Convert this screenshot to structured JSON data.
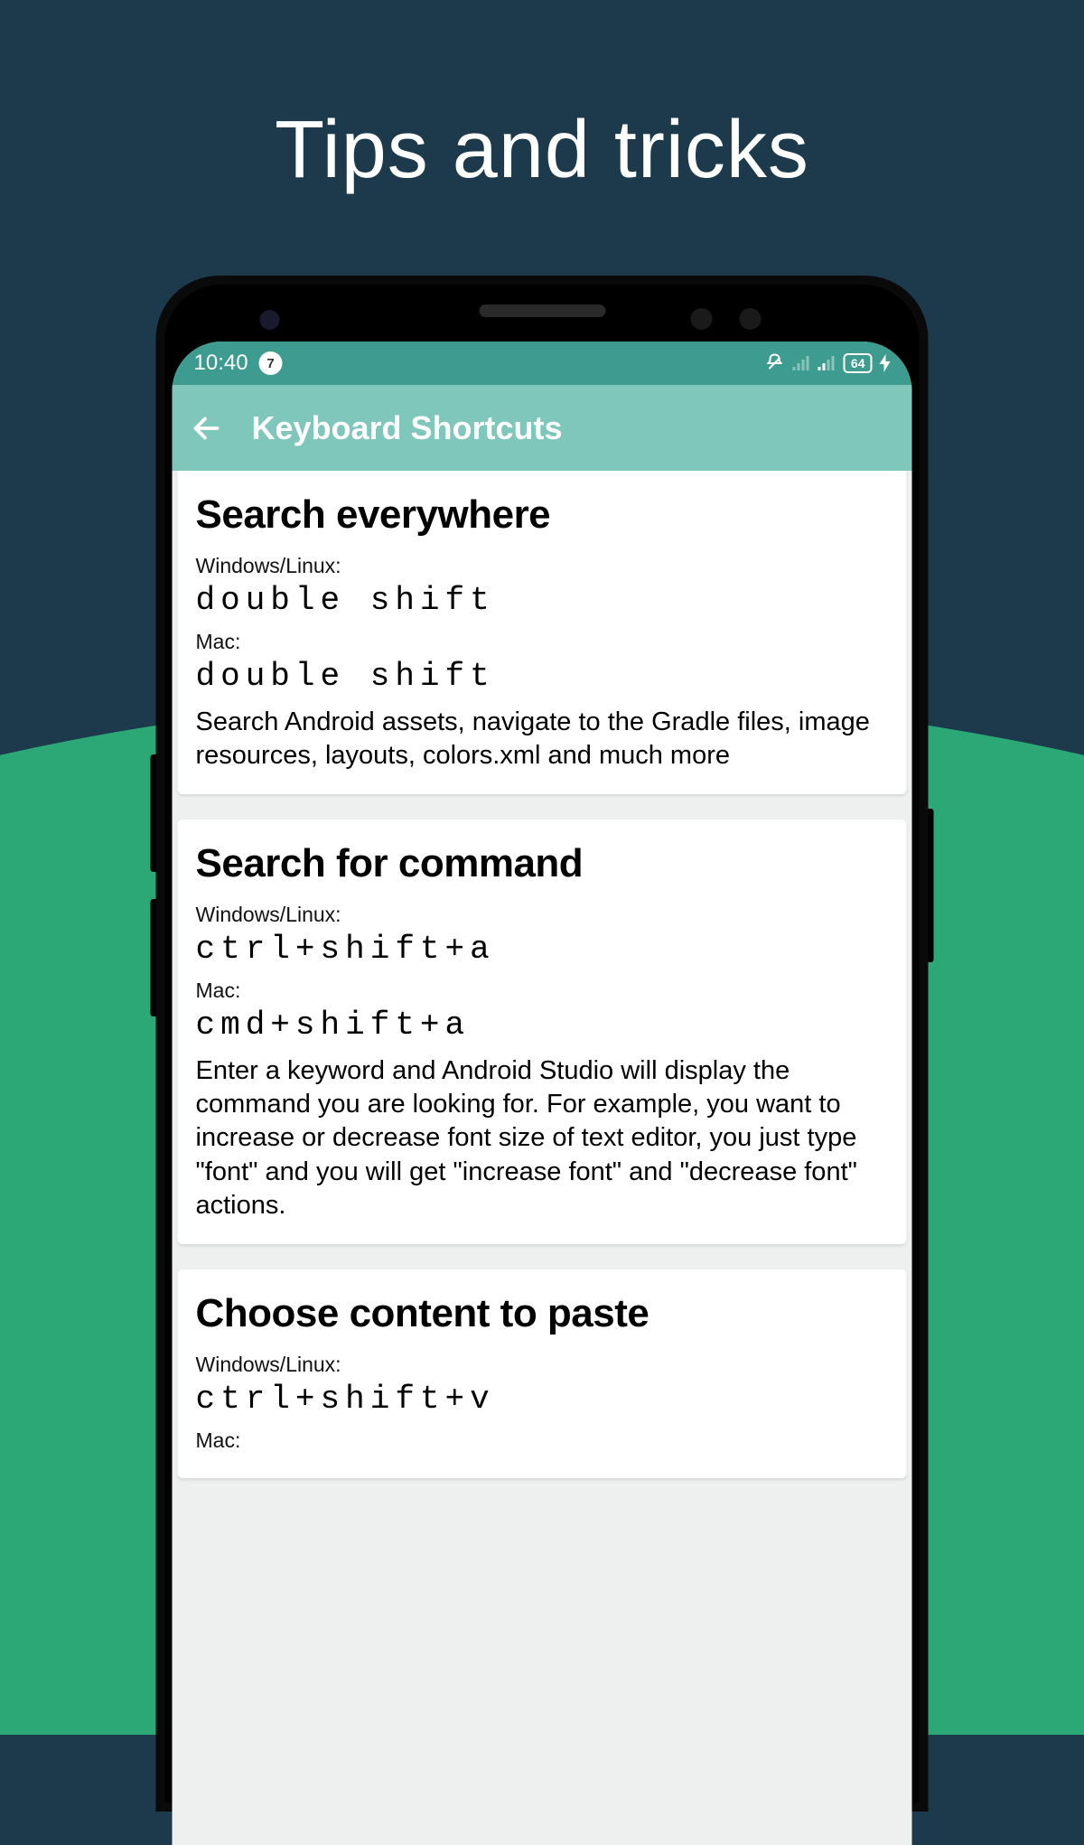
{
  "page": {
    "title": "Tips and tricks"
  },
  "status_bar": {
    "time": "10:40",
    "notification_count": "7",
    "battery": "64"
  },
  "app_bar": {
    "title": "Keyboard Shortcuts"
  },
  "cards": [
    {
      "title": "Search everywhere",
      "win_label": "Windows/Linux:",
      "win_key": "double shift",
      "mac_label": "Mac:",
      "mac_key": "double shift",
      "description": "Search Android assets, navigate to the Gradle files, image resources, layouts, colors.xml and much more"
    },
    {
      "title": "Search for command",
      "win_label": "Windows/Linux:",
      "win_key": "ctrl+shift+a",
      "mac_label": "Mac:",
      "mac_key": "cmd+shift+a",
      "description": "Enter a keyword and Android Studio will display the command you are looking for. For example, you want to increase or decrease font size of text editor, you just type \"font\" and you will get \"increase font\" and \"decrease font\" actions."
    },
    {
      "title": "Choose content to paste",
      "win_label": "Windows/Linux:",
      "win_key": "ctrl+shift+v",
      "mac_label": "Mac:",
      "mac_key": "",
      "description": ""
    }
  ]
}
